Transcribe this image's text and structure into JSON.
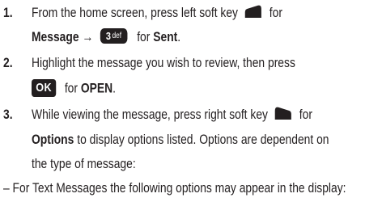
{
  "steps": [
    {
      "number": "1.",
      "line1_text": "From the home screen, press left soft key",
      "line1_after": "for",
      "line2_bold1": "Message",
      "line2_arrow": "→",
      "key3_digit": "3",
      "key3_letters": "def",
      "line2_for": "for",
      "line2_bold2": "Sent",
      "line2_end": "."
    },
    {
      "number": "2.",
      "line1_text": "Highlight the message you wish to review, then press",
      "ok_label": "OK",
      "line2_for": "for",
      "line2_bold": "OPEN",
      "line2_end": "."
    },
    {
      "number": "3.",
      "line1_text": "While viewing the message, press right soft key",
      "line1_after": "for",
      "line2_bold": "Options",
      "line2_text": "to display options listed. Options are dependent on",
      "line3_text": "the type of message:"
    }
  ],
  "note": "– For Text Messages the following options may appear in the display:",
  "icons": {
    "left_softkey": "left-soft-key-icon",
    "right_softkey": "right-soft-key-icon",
    "key3": "key-3-def-icon",
    "ok_key": "ok-key-icon"
  }
}
